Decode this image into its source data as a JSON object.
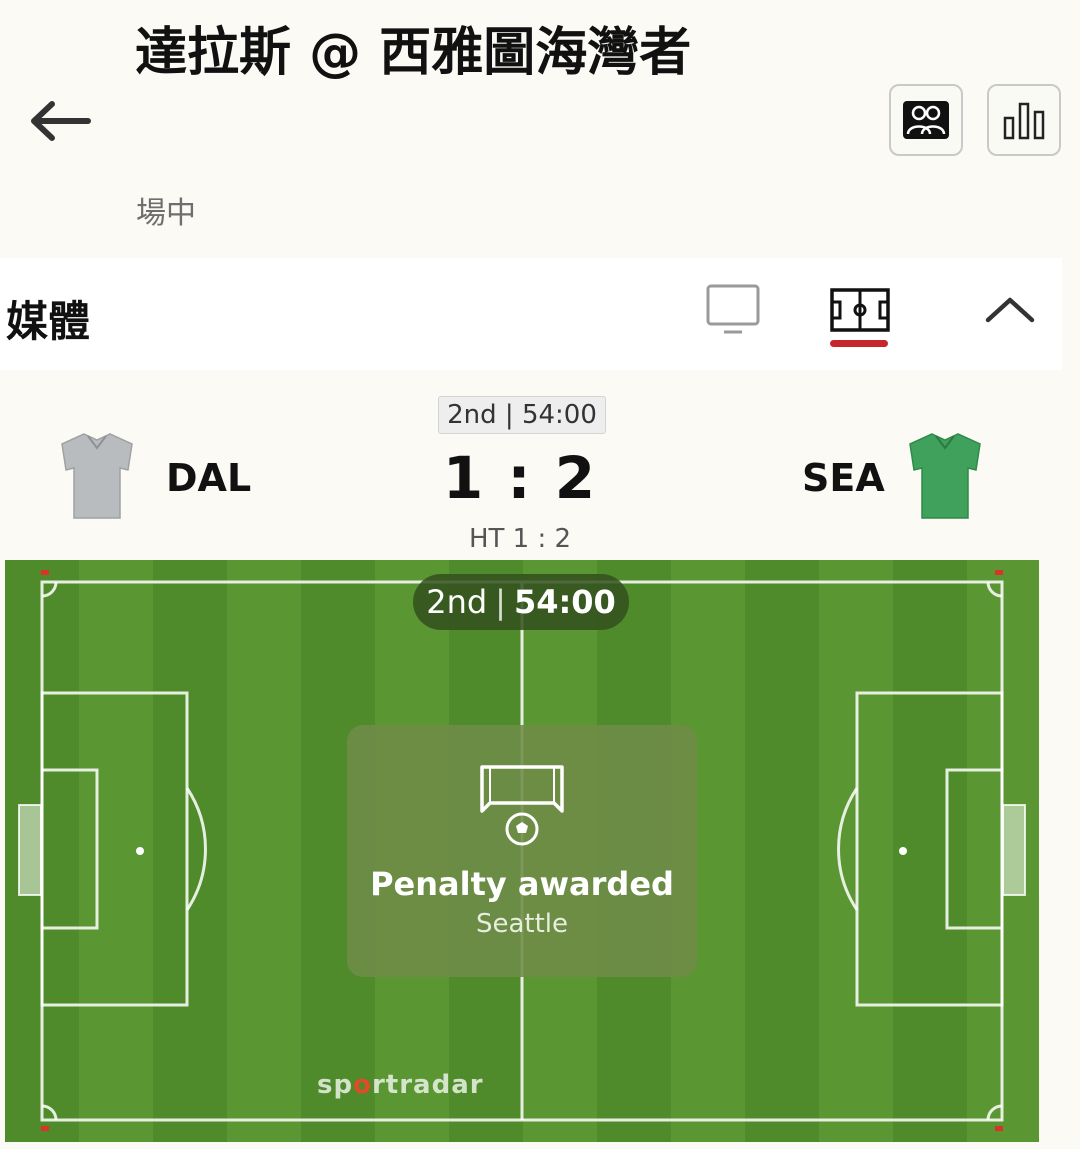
{
  "header": {
    "title": "達拉斯 @ 西雅圖海灣者",
    "status": "場中",
    "back_icon": "arrow-left-icon",
    "buttons": [
      {
        "icon": "lineups-icon"
      },
      {
        "icon": "stats-bar-chart-icon"
      }
    ]
  },
  "media": {
    "title": "媒體",
    "tabs": [
      {
        "icon": "tv-icon",
        "active": false
      },
      {
        "icon": "pitch-icon",
        "active": true
      }
    ],
    "collapse_icon": "chevron-up-icon",
    "accent_color": "#c8262d"
  },
  "scoreboard": {
    "period_time": "2nd | 54:00",
    "home": {
      "abbr": "DAL",
      "shirt_color": "#b9bcbf"
    },
    "away": {
      "abbr": "SEA",
      "shirt_color": "#3fa15c"
    },
    "score": "1 : 2",
    "halftime": "HT 1 : 2"
  },
  "pitch": {
    "period": "2nd",
    "clock": "54:00",
    "event": {
      "icon": "penalty-goal-icon",
      "title": "Penalty awarded",
      "team": "Seattle"
    },
    "brand": {
      "pre": "sp",
      "o": "o",
      "post": "rtradar"
    }
  }
}
